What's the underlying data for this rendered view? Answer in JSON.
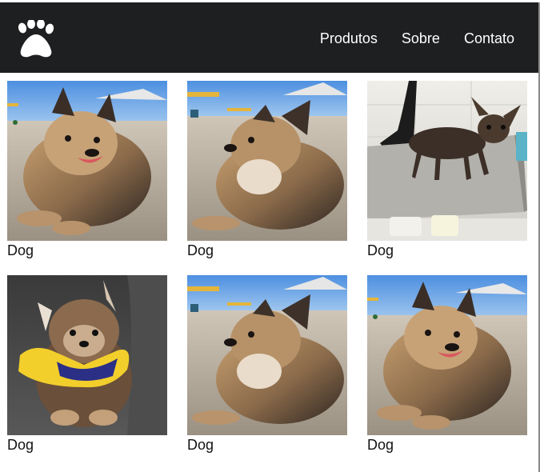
{
  "nav": {
    "logo_icon": "paw-icon",
    "links": [
      "Produtos",
      "Sobre",
      "Contato"
    ]
  },
  "gallery": {
    "items": [
      {
        "caption": "Dog",
        "photo": "pomeranian-beach-smiling-photo"
      },
      {
        "caption": "Dog",
        "photo": "pomeranian-beach-side-photo"
      },
      {
        "caption": "Dog",
        "photo": "wet-chihuahua-grooming-table-photo"
      },
      {
        "caption": "Dog",
        "photo": "pomeranian-yellow-jacket-sofa-photo"
      },
      {
        "caption": "Dog",
        "photo": "pomeranian-beach-side-photo"
      },
      {
        "caption": "Dog",
        "photo": "pomeranian-beach-smiling-photo"
      }
    ]
  },
  "colors": {
    "navbar": "#1e1f21",
    "nav_text": "#ffffff",
    "caption_text": "#111111"
  }
}
